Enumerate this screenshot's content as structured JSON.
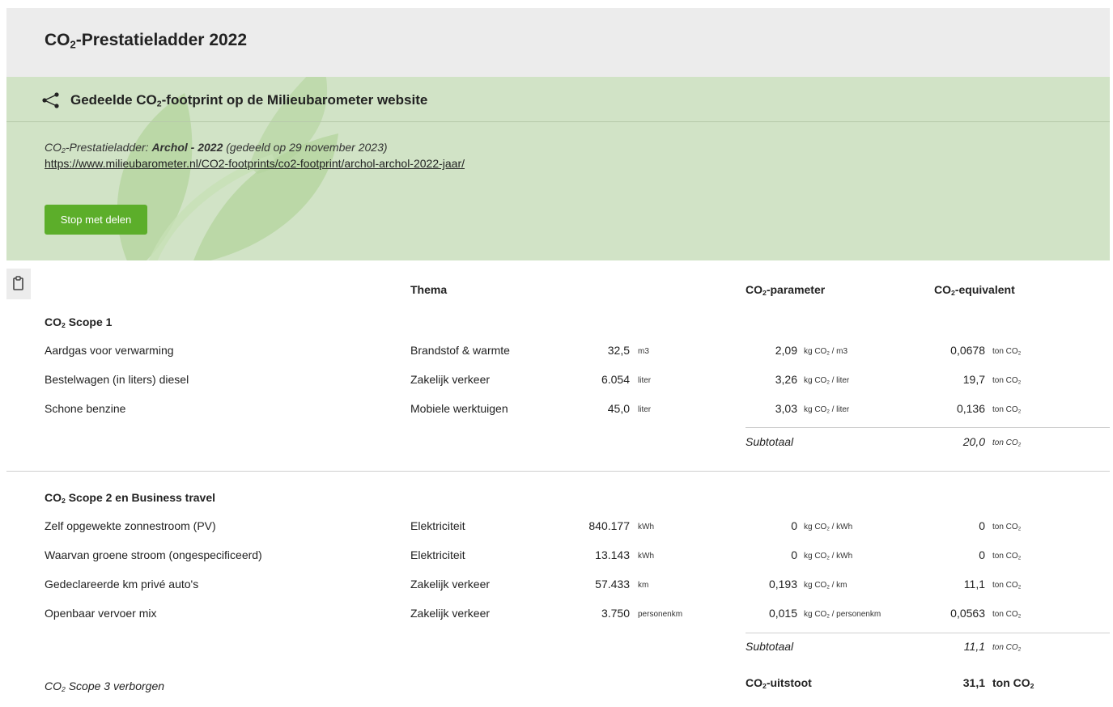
{
  "header": {
    "title_pre": "CO",
    "title_sub": "2",
    "title_post": "-Prestatieladder 2022"
  },
  "share": {
    "title_pre": "Gedeelde CO",
    "title_sub": "2",
    "title_post": "-footprint op de Milieubarometer website",
    "desc_pre": "CO",
    "desc_sub": "2",
    "desc_mid": "-Prestatieladder: ",
    "desc_bold": "Archol - 2022",
    "desc_post": " (gedeeld op 29 november 2023)",
    "link": "https://www.milieubarometer.nl/CO2-footprints/co2-footprint/archol-archol-2022-jaar/",
    "button_label": "Stop met delen"
  },
  "table": {
    "col_thema": "Thema",
    "col_param_pre": "CO",
    "col_param_sub": "2",
    "col_param_post": "-parameter",
    "col_equiv_pre": "CO",
    "col_equiv_sub": "2",
    "col_equiv_post": "-equivalent",
    "scope1": {
      "title_pre": "CO",
      "title_sub": "2",
      "title_post": " Scope 1",
      "rows": [
        {
          "name": "Aardgas voor verwarming",
          "thema": "Brandstof & warmte",
          "amount": "32,5",
          "unit": "m3",
          "param": "2,09",
          "param_unit_pre": "kg CO",
          "param_unit_sub": "2",
          "param_unit_post": " / m3",
          "equiv": "0,0678",
          "equiv_unit_pre": "ton CO",
          "equiv_unit_sub": "2"
        },
        {
          "name": "Bestelwagen (in liters) diesel",
          "thema": "Zakelijk verkeer",
          "amount": "6.054",
          "unit": "liter",
          "param": "3,26",
          "param_unit_pre": "kg CO",
          "param_unit_sub": "2",
          "param_unit_post": " / liter",
          "equiv": "19,7",
          "equiv_unit_pre": "ton CO",
          "equiv_unit_sub": "2"
        },
        {
          "name": "Schone benzine",
          "thema": "Mobiele werktuigen",
          "amount": "45,0",
          "unit": "liter",
          "param": "3,03",
          "param_unit_pre": "kg CO",
          "param_unit_sub": "2",
          "param_unit_post": " / liter",
          "equiv": "0,136",
          "equiv_unit_pre": "ton CO",
          "equiv_unit_sub": "2"
        }
      ],
      "subtotal_label": "Subtotaal",
      "subtotal_value": "20,0",
      "subtotal_unit_pre": "ton CO",
      "subtotal_unit_sub": "2"
    },
    "scope2": {
      "title_pre": "CO",
      "title_sub": "2",
      "title_post": " Scope 2 en Business travel",
      "rows": [
        {
          "name": "Zelf opgewekte zonnestroom (PV)",
          "thema": "Elektriciteit",
          "amount": "840.177",
          "unit": "kWh",
          "param": "0",
          "param_unit_pre": "kg CO",
          "param_unit_sub": "2",
          "param_unit_post": " / kWh",
          "equiv": "0",
          "equiv_unit_pre": "ton CO",
          "equiv_unit_sub": "2"
        },
        {
          "name": "Waarvan groene stroom (ongespecificeerd)",
          "thema": "Elektriciteit",
          "amount": "13.143",
          "unit": "kWh",
          "param": "0",
          "param_unit_pre": "kg CO",
          "param_unit_sub": "2",
          "param_unit_post": " / kWh",
          "equiv": "0",
          "equiv_unit_pre": "ton CO",
          "equiv_unit_sub": "2"
        },
        {
          "name": "Gedeclareerde km privé auto's",
          "thema": "Zakelijk verkeer",
          "amount": "57.433",
          "unit": "km",
          "param": "0,193",
          "param_unit_pre": "kg CO",
          "param_unit_sub": "2",
          "param_unit_post": " / km",
          "equiv": "11,1",
          "equiv_unit_pre": "ton CO",
          "equiv_unit_sub": "2"
        },
        {
          "name": "Openbaar vervoer mix",
          "thema": "Zakelijk verkeer",
          "amount": "3.750",
          "unit": "personenkm",
          "param": "0,015",
          "param_unit_pre": "kg CO",
          "param_unit_sub": "2",
          "param_unit_post": " / personenkm",
          "equiv": "0,0563",
          "equiv_unit_pre": "ton CO",
          "equiv_unit_sub": "2"
        }
      ],
      "subtotal_label": "Subtotaal",
      "subtotal_value": "11,1",
      "subtotal_unit_pre": "ton CO",
      "subtotal_unit_sub": "2"
    },
    "scope3_pre": "CO",
    "scope3_sub": "2",
    "scope3_post": " Scope 3 verborgen",
    "total_label_pre": "CO",
    "total_label_sub": "2",
    "total_label_post": "-uitstoot",
    "total_value": "31,1",
    "total_unit_pre": "ton CO",
    "total_unit_sub": "2"
  },
  "icons": {
    "share": "share-icon",
    "clipboard": "clipboard-icon",
    "leaf": "leaf-watermark"
  },
  "colors": {
    "header_bg": "#ececec",
    "share_bg": "#d1e3c6",
    "button_green": "#5cae2a"
  }
}
